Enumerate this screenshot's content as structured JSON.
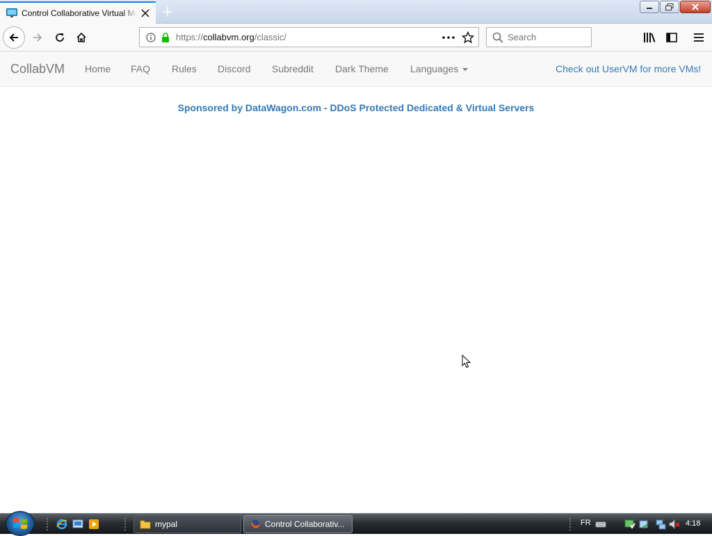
{
  "browser": {
    "tab_title": "Control Collaborative Virtual Machines",
    "url_scheme": "https://",
    "url_host": "collabvm.org",
    "url_path": "/classic/",
    "search_placeholder": "Search",
    "accent_color": "#0a84ff"
  },
  "site": {
    "brand": "CollabVM",
    "nav_items": [
      {
        "label": "Home"
      },
      {
        "label": "FAQ"
      },
      {
        "label": "Rules"
      },
      {
        "label": "Discord"
      },
      {
        "label": "Subreddit"
      },
      {
        "label": "Dark Theme"
      },
      {
        "label": "Languages"
      }
    ],
    "right_link": "Check out UserVM for more VMs!",
    "sponsor_text": "Sponsored by DataWagon.com - DDoS Protected Dedicated & Virtual Servers",
    "link_color": "#337ab7"
  },
  "taskbar": {
    "tasks": [
      {
        "label": "mypal",
        "icon": "folder-icon"
      },
      {
        "label": "Control Collaborativ...",
        "icon": "firefox-icon"
      }
    ],
    "language": "FR",
    "clock": "4:18"
  }
}
